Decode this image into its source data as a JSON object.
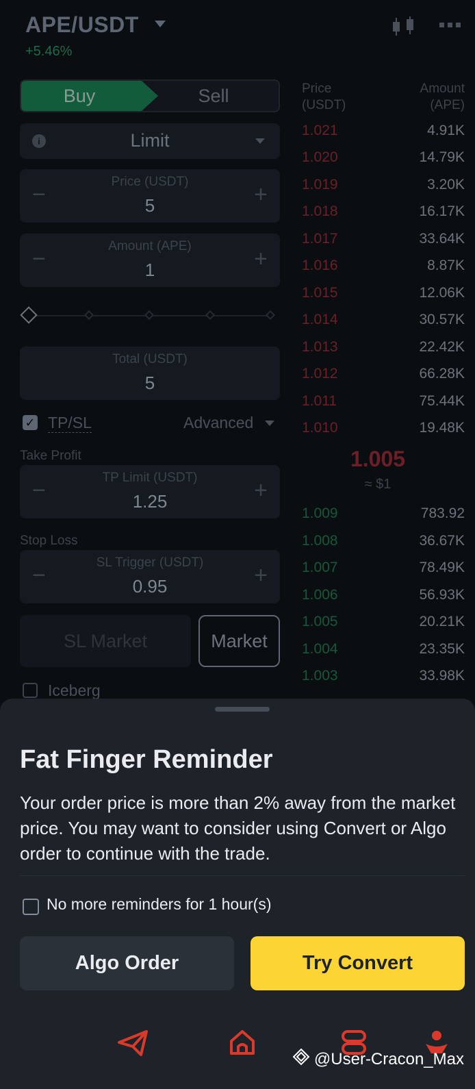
{
  "header": {
    "pair": "APE/USDT",
    "change": "+5.46%"
  },
  "order_form": {
    "tabs": {
      "buy": "Buy",
      "sell": "Sell"
    },
    "order_type": "Limit",
    "price": {
      "label": "Price (USDT)",
      "value": "5"
    },
    "amount": {
      "label": "Amount (APE)",
      "value": "1"
    },
    "total": {
      "label": "Total (USDT)",
      "value": "5"
    },
    "tpsl_label": "TP/SL",
    "advanced_label": "Advanced",
    "take_profit": {
      "section": "Take Profit",
      "label": "TP Limit (USDT)",
      "value": "1.25"
    },
    "stop_loss": {
      "section": "Stop Loss",
      "label": "SL Trigger (USDT)",
      "value": "0.95"
    },
    "sl_market_label": "SL Market",
    "market_label": "Market",
    "iceberg_label": "Iceberg"
  },
  "order_book": {
    "price_header": "Price\n(USDT)",
    "amount_header": "Amount\n(APE)",
    "asks": [
      {
        "price": "1.021",
        "amount": "4.91K"
      },
      {
        "price": "1.020",
        "amount": "14.79K"
      },
      {
        "price": "1.019",
        "amount": "3.20K"
      },
      {
        "price": "1.018",
        "amount": "16.17K"
      },
      {
        "price": "1.017",
        "amount": "33.64K"
      },
      {
        "price": "1.016",
        "amount": "8.87K"
      },
      {
        "price": "1.015",
        "amount": "12.06K"
      },
      {
        "price": "1.014",
        "amount": "30.57K"
      },
      {
        "price": "1.013",
        "amount": "22.42K"
      },
      {
        "price": "1.012",
        "amount": "66.28K"
      },
      {
        "price": "1.011",
        "amount": "75.44K"
      },
      {
        "price": "1.010",
        "amount": "19.48K"
      }
    ],
    "mid_price": "1.005",
    "mid_usd": "≈ $1",
    "bids": [
      {
        "price": "1.009",
        "amount": "783.92"
      },
      {
        "price": "1.008",
        "amount": "36.67K"
      },
      {
        "price": "1.007",
        "amount": "78.49K"
      },
      {
        "price": "1.006",
        "amount": "56.93K"
      },
      {
        "price": "1.005",
        "amount": "20.21K"
      },
      {
        "price": "1.004",
        "amount": "23.35K"
      },
      {
        "price": "1.003",
        "amount": "33.98K"
      }
    ]
  },
  "sheet": {
    "title": "Fat Finger Reminder",
    "body": "Your order price is more than 2% away from the market price. You may want to consider using Convert or Algo order to continue with the trade.",
    "checkbox_label": "No more reminders for 1 hour(s)",
    "algo_button": "Algo Order",
    "convert_button": "Try Convert"
  },
  "watermark": "@User-Cracon_Max",
  "colors": {
    "accent_yellow": "#fcd535",
    "ask_red": "#f6465d",
    "bid_green": "#0ecb81",
    "sheet_bg": "#1e2329",
    "nav_red": "#d93a2b"
  }
}
